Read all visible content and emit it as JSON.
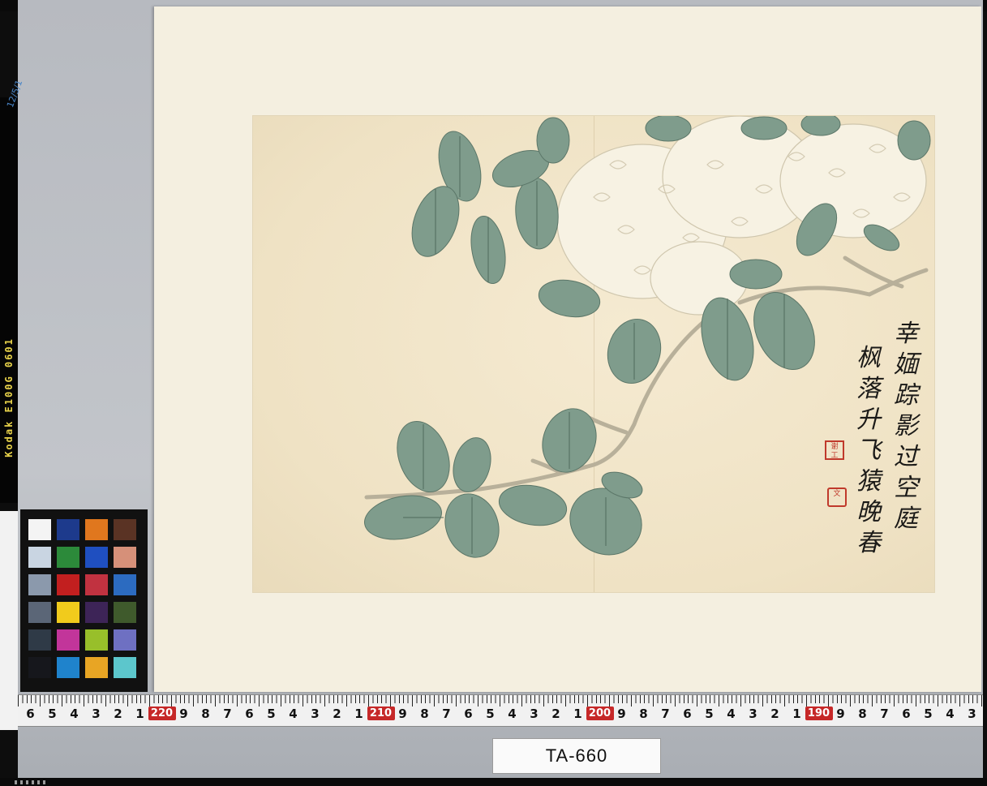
{
  "film": {
    "code": "Kodak  E100G  0601",
    "handwritten_mark": "12/5/1"
  },
  "painting": {
    "poem_column_1": [
      "幸",
      "媔",
      "踪",
      "影",
      "过",
      "空",
      "庭"
    ],
    "poem_column_2": [
      "枫",
      "落",
      "升",
      "飞",
      "猿",
      "晚",
      "春"
    ],
    "seal_1": "谢 工",
    "seal_2": "文"
  },
  "color_checker": {
    "swatches": [
      "#f4f4f4",
      "#1d3a8c",
      "#e0771e",
      "#5a3324",
      "#c9d5e2",
      "#2c8a3a",
      "#1f4fc0",
      "#d69079",
      "#8b99ac",
      "#c21f1f",
      "#c13240",
      "#2c6bc0",
      "#5b6677",
      "#f1cb1c",
      "#3d2457",
      "#3f5a2c",
      "#2f3a47",
      "#c2359a",
      "#98bf2a",
      "#6e70c2",
      "#16171c",
      "#1f83cc",
      "#e8a524",
      "#5cc6cc"
    ]
  },
  "ruler": {
    "marks": [
      "6",
      "5",
      "4",
      "3",
      "2",
      "1",
      "220",
      "9",
      "8",
      "7",
      "6",
      "5",
      "4",
      "3",
      "2",
      "1",
      "210",
      "9",
      "8",
      "7",
      "6",
      "5",
      "4",
      "3",
      "2",
      "1",
      "200",
      "9",
      "8",
      "7",
      "6",
      "5",
      "4",
      "3",
      "2",
      "1",
      "190",
      "9",
      "8",
      "7",
      "6",
      "5",
      "4",
      "3"
    ],
    "major_marks": [
      "220",
      "210",
      "200",
      "190"
    ]
  },
  "catalog_label": "TA-660"
}
